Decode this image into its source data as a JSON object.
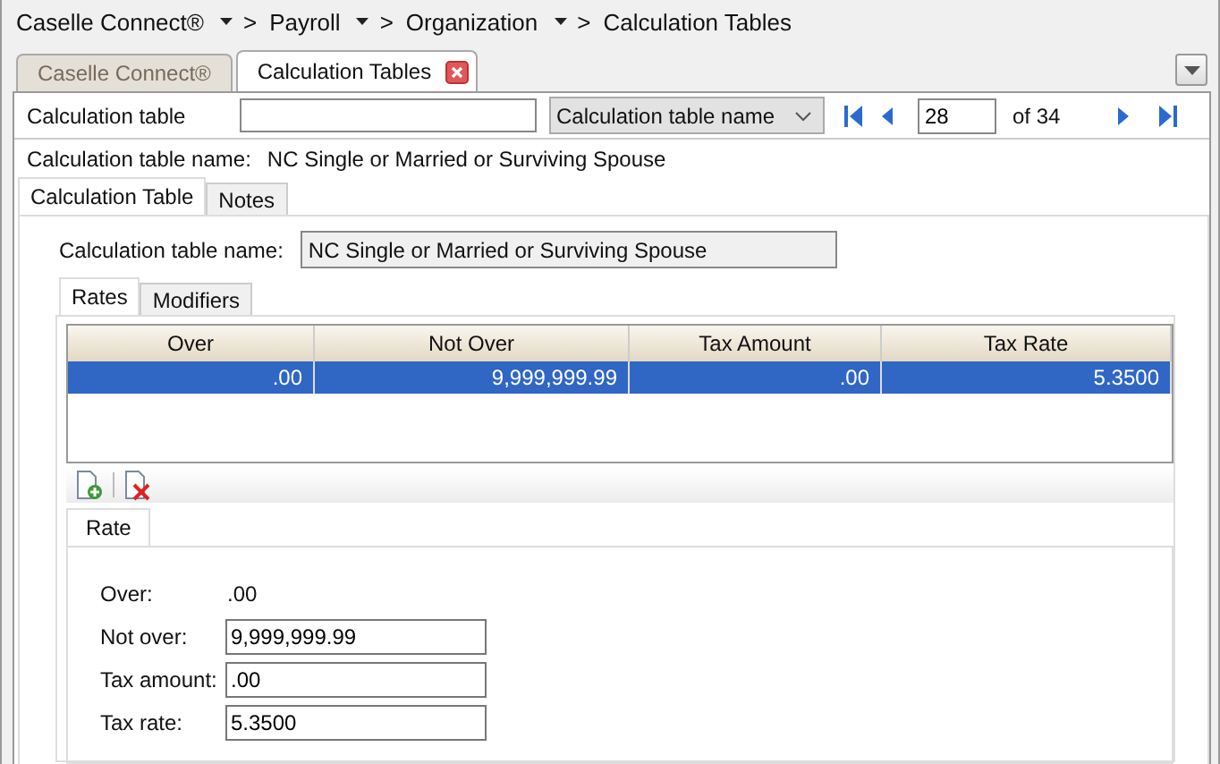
{
  "breadcrumb": [
    {
      "label": "Caselle Connect®",
      "dropdown": true,
      "separator": ">"
    },
    {
      "label": "Payroll",
      "dropdown": true,
      "separator": ">"
    },
    {
      "label": "Organization",
      "dropdown": true,
      "separator": ">"
    },
    {
      "label": "Calculation Tables",
      "dropdown": false
    }
  ],
  "doc_tabs": [
    {
      "label": "Caselle Connect®",
      "selected": false,
      "closable": false
    },
    {
      "label": "Calculation Tables",
      "selected": true,
      "closable": true
    }
  ],
  "toolbar": {
    "label": "Calculation table",
    "select_value": "Calculation table name",
    "record": "28",
    "total": "of 34"
  },
  "info": {
    "label": "Calculation table name:",
    "value": "NC Single or Married or Surviving Spouse"
  },
  "tabs": [
    {
      "label": "Calculation Table",
      "selected": true
    },
    {
      "label": "Notes",
      "selected": false
    }
  ],
  "name_field": {
    "label": "Calculation table name:",
    "value": "NC Single or Married or Surviving Spouse"
  },
  "sub_tabs": [
    {
      "label": "Rates",
      "selected": true
    },
    {
      "label": "Modifiers",
      "selected": false
    }
  ],
  "table": {
    "columns": [
      "Over",
      "Not Over",
      "Tax Amount",
      "Tax Rate"
    ],
    "rows": [
      {
        "cells": [
          ".00",
          "9,999,999.99",
          ".00",
          "5.3500"
        ],
        "selected": true
      }
    ]
  },
  "detail_tabs": [
    {
      "label": "Rate",
      "selected": true
    }
  ],
  "form": [
    {
      "label": "Over:",
      "value": ".00",
      "kind": "text"
    },
    {
      "label": "Not over:",
      "value": "9,999,999.99",
      "kind": "input"
    },
    {
      "label": "Tax amount:",
      "value": ".00",
      "kind": "input"
    },
    {
      "label": "Tax rate:",
      "value": "5.3500",
      "kind": "input"
    }
  ]
}
